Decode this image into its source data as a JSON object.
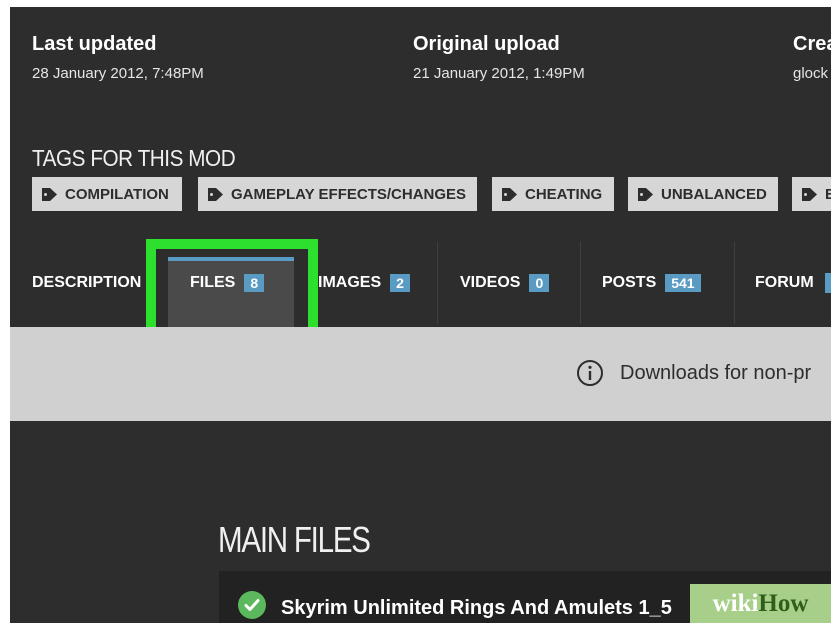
{
  "meta": {
    "last_updated": {
      "label": "Last updated",
      "value": "28 January 2012,  7:48PM"
    },
    "original_upload": {
      "label": "Original upload",
      "value": "21 January 2012,  1:49PM"
    },
    "created": {
      "label": "Crea",
      "value": "glock"
    }
  },
  "tags": {
    "heading": "TAGS FOR THIS MOD",
    "items": [
      "COMPILATION",
      "GAMEPLAY EFFECTS/CHANGES",
      "CHEATING",
      "UNBALANCED",
      "E"
    ]
  },
  "tabs": [
    {
      "label": "DESCRIPTION",
      "count": null
    },
    {
      "label": "FILES",
      "count": "8"
    },
    {
      "label": "IMAGES",
      "count": "2"
    },
    {
      "label": "VIDEOS",
      "count": "0"
    },
    {
      "label": "POSTS",
      "count": "541"
    },
    {
      "label": "FORUM",
      "count": ""
    }
  ],
  "notice": {
    "text": "Downloads for non-pr",
    "icon": "info-icon"
  },
  "main_files": {
    "heading": "MAIN FILES",
    "first_file": "Skyrim Unlimited Rings And Amulets 1_5"
  },
  "watermark": {
    "part1": "wiki",
    "part2": "How"
  },
  "colors": {
    "background": "#2d2d2d",
    "tab_count": "#5a9bc4",
    "highlight": "#2ee02e",
    "tag_bg": "#d6d6d6",
    "check": "#5cb85c"
  }
}
